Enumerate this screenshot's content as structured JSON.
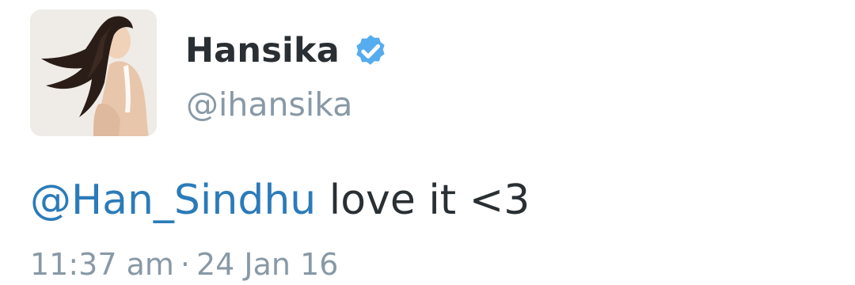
{
  "tweet": {
    "author_name": "Hansika",
    "handle": "@ihansika",
    "verified_icon": "verified-badge-icon",
    "mention": "@Han_Sindhu",
    "body_text": " love it <3",
    "time": "11:37 am",
    "separator": "·",
    "date": "24 Jan 16"
  },
  "colors": {
    "text": "#292f33",
    "muted": "#8899a6",
    "link": "#2b7bb9",
    "verified": "#55acee"
  }
}
